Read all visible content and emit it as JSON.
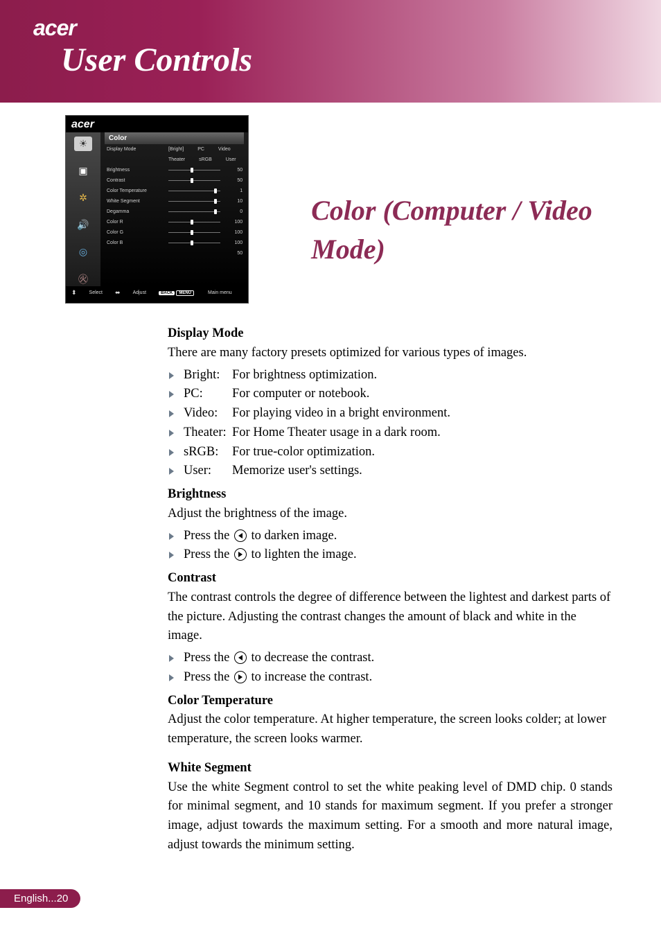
{
  "header": {
    "brand": "acer",
    "section_title": "User Controls"
  },
  "osd": {
    "brand": "acer",
    "panel_title": "Color",
    "mode_label": "Display Mode",
    "mode_row1": [
      "[Bright]",
      "PC",
      "Video"
    ],
    "mode_row2": [
      "Theater",
      "sRGB",
      "User"
    ],
    "sliders": [
      {
        "label": "Brightness",
        "pos": 43,
        "val": "50"
      },
      {
        "label": "Contrast",
        "pos": 43,
        "val": "50"
      },
      {
        "label": "Color Temperature",
        "pos": 88,
        "val": "1"
      },
      {
        "label": "White Segment",
        "pos": 88,
        "val": "10"
      },
      {
        "label": "Degamma",
        "pos": 88,
        "val": "0"
      },
      {
        "label": "Color R",
        "pos": 43,
        "val": "100"
      },
      {
        "label": "Color G",
        "pos": 43,
        "val": "100"
      },
      {
        "label": "Color B",
        "pos": 43,
        "val": "100"
      }
    ],
    "extra_val": "50",
    "footer": {
      "select": "Select",
      "adjust": "Adjust",
      "back_tag": "BACK",
      "menu_tag": "MENU",
      "main": "Main menu"
    }
  },
  "panel_title_text": "Color (Computer / Video Mode)",
  "doc": {
    "dm_h": "Display Mode",
    "dm_p": "There are many factory presets optimized for various types of images.",
    "modes": [
      {
        "k": "Bright:",
        "v": "For brightness optimization."
      },
      {
        "k": "PC:",
        "v": "For computer or notebook."
      },
      {
        "k": "Video:",
        "v": "For playing video in a bright environment."
      },
      {
        "k": "Theater:",
        "v": "For Home Theater usage in a dark room."
      },
      {
        "k": "sRGB:",
        "v": "For true-color optimization."
      },
      {
        "k": "User:",
        "v": "Memorize user's settings."
      }
    ],
    "br_h": "Brightness",
    "br_p": "Adjust the brightness of the image.",
    "br_b1a": "Press the ",
    "br_b1b": " to darken image.",
    "br_b2a": "Press the ",
    "br_b2b": " to lighten the image.",
    "ct_h": "Contrast",
    "ct_p": "The contrast controls the degree of difference between the lightest and darkest parts of the picture. Adjusting the contrast changes the amount of black and white in the image.",
    "ct_b1a": "Press the ",
    "ct_b1b": " to decrease the contrast.",
    "ct_b2a": "Press the ",
    "ct_b2b": " to increase the contrast.",
    "temp_h": "Color Temperature",
    "temp_p": "Adjust the color temperature. At higher temperature, the screen looks colder; at lower temperature, the screen looks warmer.",
    "ws_h": "White Segment",
    "ws_p": "Use the white Segment control to set the white peaking level of DMD chip. 0 stands for minimal segment, and 10 stands for maximum segment. If you prefer a stronger image, adjust towards the maximum setting. For a smooth and more natural image, adjust towards the minimum setting."
  },
  "footer": {
    "page": "English...20"
  }
}
